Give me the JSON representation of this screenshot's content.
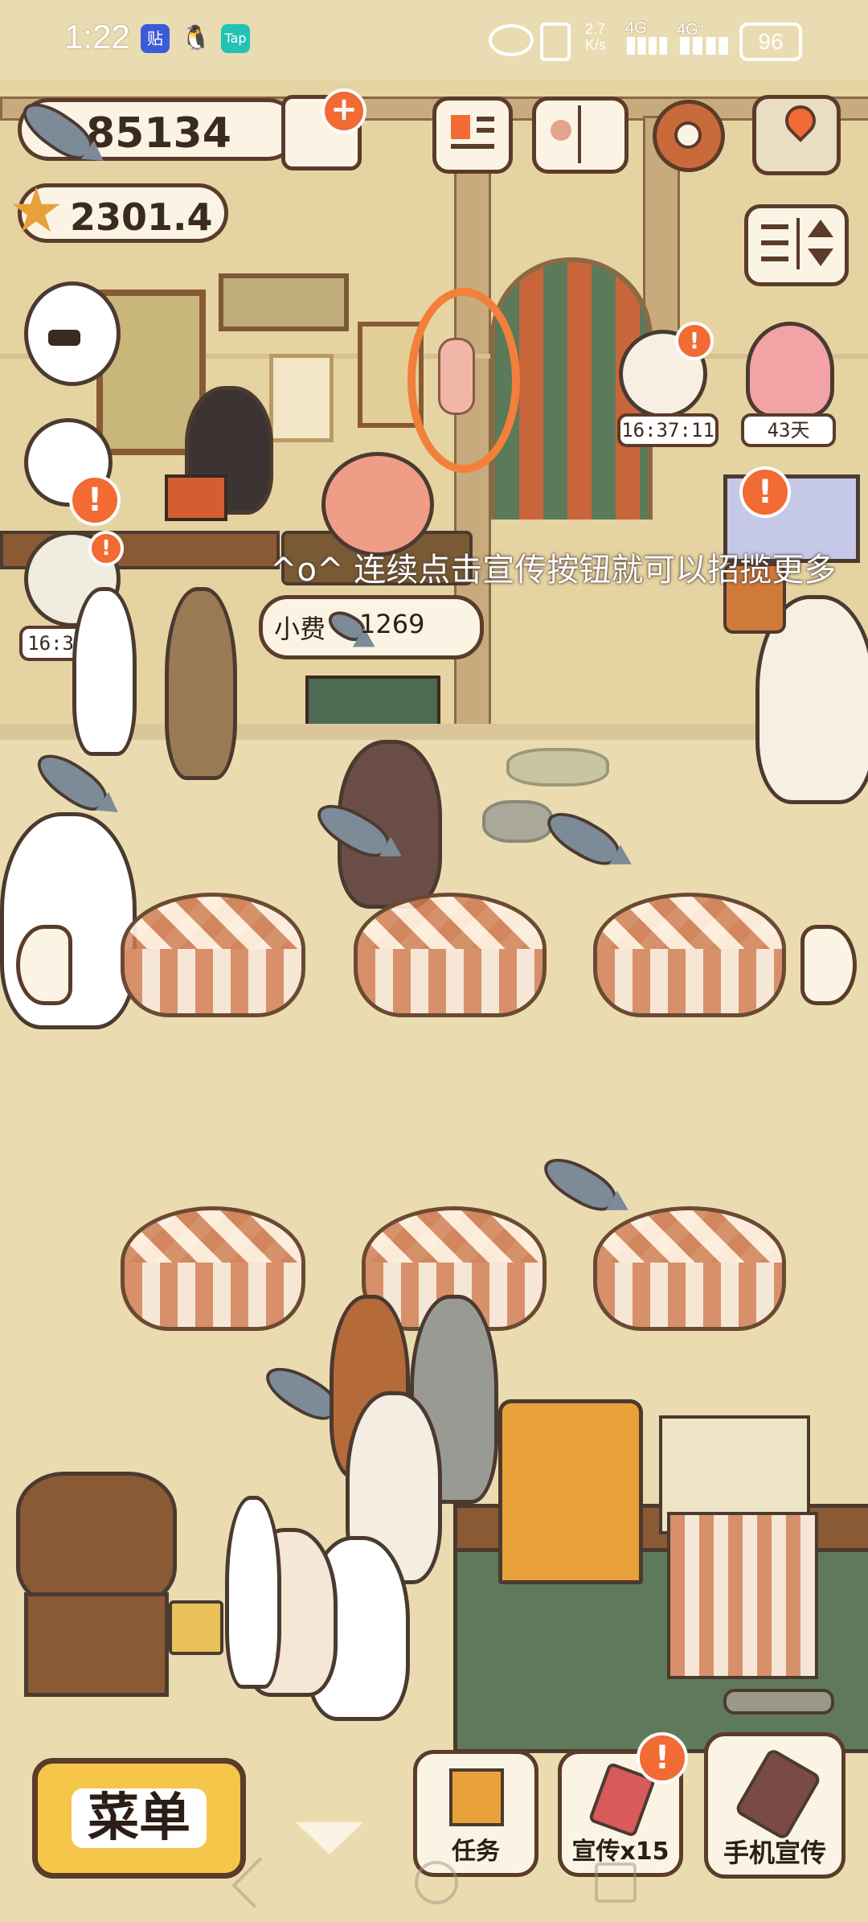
{
  "status_bar": {
    "time": "1:22",
    "network_speed": "2.7\nK/s",
    "net1": "4G",
    "net2": "4G⁺",
    "battery": "96",
    "app_icons": [
      "贴",
      "🐧",
      "Tap"
    ]
  },
  "currency": {
    "fish": "85134",
    "stars": "2301.4"
  },
  "notice": {
    "text": "^o^ 连续点击宣传按钮就可以招揽更多"
  },
  "tip": {
    "label": "小费",
    "value": "1269"
  },
  "timers": {
    "left": "16:37:11",
    "right": "16:37:11",
    "days": "43天"
  },
  "buttons": {
    "menu": "菜单",
    "tasks": "任务",
    "promote": "宣传x15",
    "phone_promote": "手机宣传"
  },
  "badges": {
    "alert": "!"
  },
  "colors": {
    "accent": "#f26a34",
    "outline": "#5b3b2a",
    "menu_button": "#f6c64b",
    "highlight_ring": "#f2803a"
  },
  "icons": [
    "fish-icon",
    "star-icon",
    "shop-cart-icon",
    "newspaper-icon",
    "album-icon",
    "gear-icon",
    "map-icon",
    "filter-icon",
    "checklist-icon",
    "phone-icon"
  ]
}
